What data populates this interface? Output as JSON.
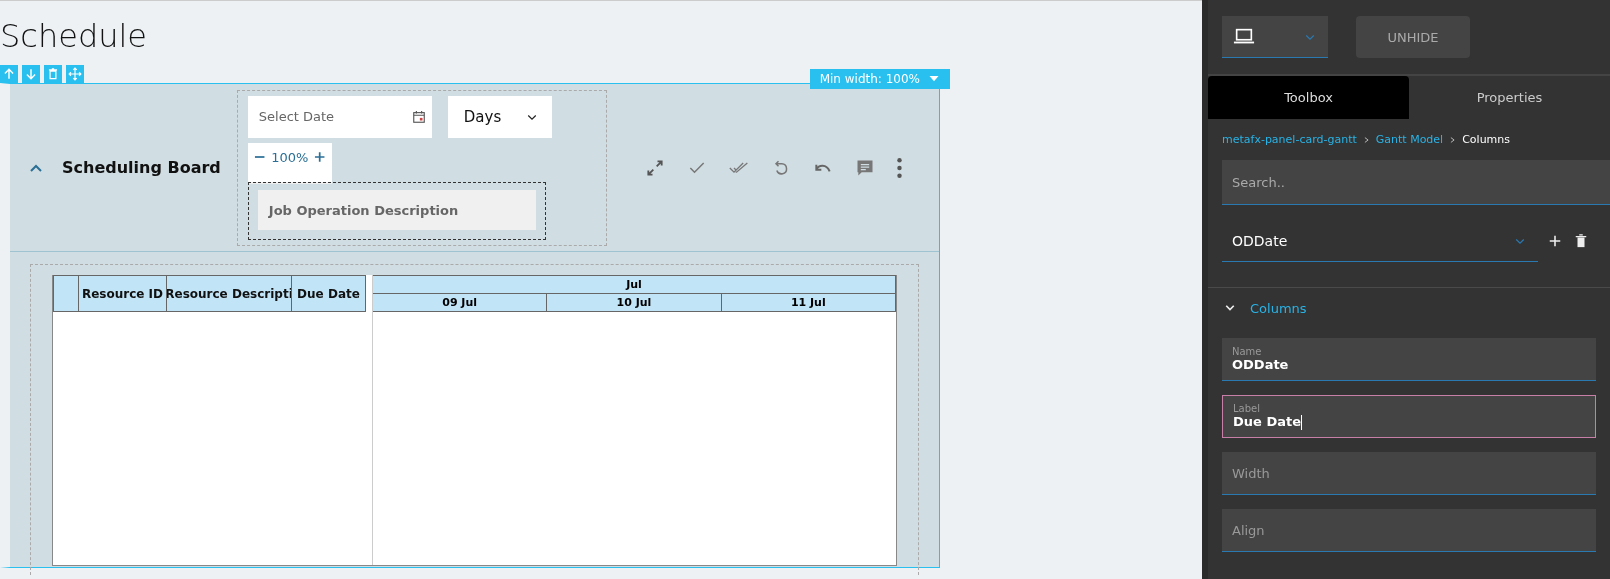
{
  "page": {
    "title": "Schedule"
  },
  "min_width_badge": "Min width: 100%",
  "card": {
    "title": "Scheduling Board",
    "expanded": true,
    "date_field": {
      "placeholder": "Select Date"
    },
    "view_dropdown": {
      "value": "Days"
    },
    "zoom": {
      "value": "100%"
    },
    "group_chip": "Job Operation Description"
  },
  "gantt": {
    "columns": [
      "",
      "Resource ID",
      "Resource Descripti",
      "Due Date"
    ],
    "month": "Jul",
    "days": [
      "09 Jul",
      "10 Jul",
      "11 Jul"
    ]
  },
  "panel": {
    "unhide_button": "UNHIDE",
    "tabs": [
      {
        "label": "Toolbox",
        "selected": true
      },
      {
        "label": "Properties",
        "selected": false
      }
    ],
    "breadcrumb": [
      {
        "label": "metafx-panel-card-gantt",
        "link": true
      },
      {
        "label": "Gantt Model",
        "link": true
      },
      {
        "label": "Columns",
        "link": false
      }
    ],
    "search": {
      "placeholder": "Search.."
    },
    "column_select": {
      "value": "ODDate"
    },
    "section": {
      "title": "Columns",
      "expanded": true
    },
    "fields": [
      {
        "label": "Name",
        "value": "ODDate",
        "focused": false
      },
      {
        "label": "Label",
        "value": "Due Date",
        "focused": true
      },
      {
        "placeholder": "Width",
        "focused": false
      },
      {
        "placeholder": "Align",
        "focused": false
      }
    ]
  }
}
